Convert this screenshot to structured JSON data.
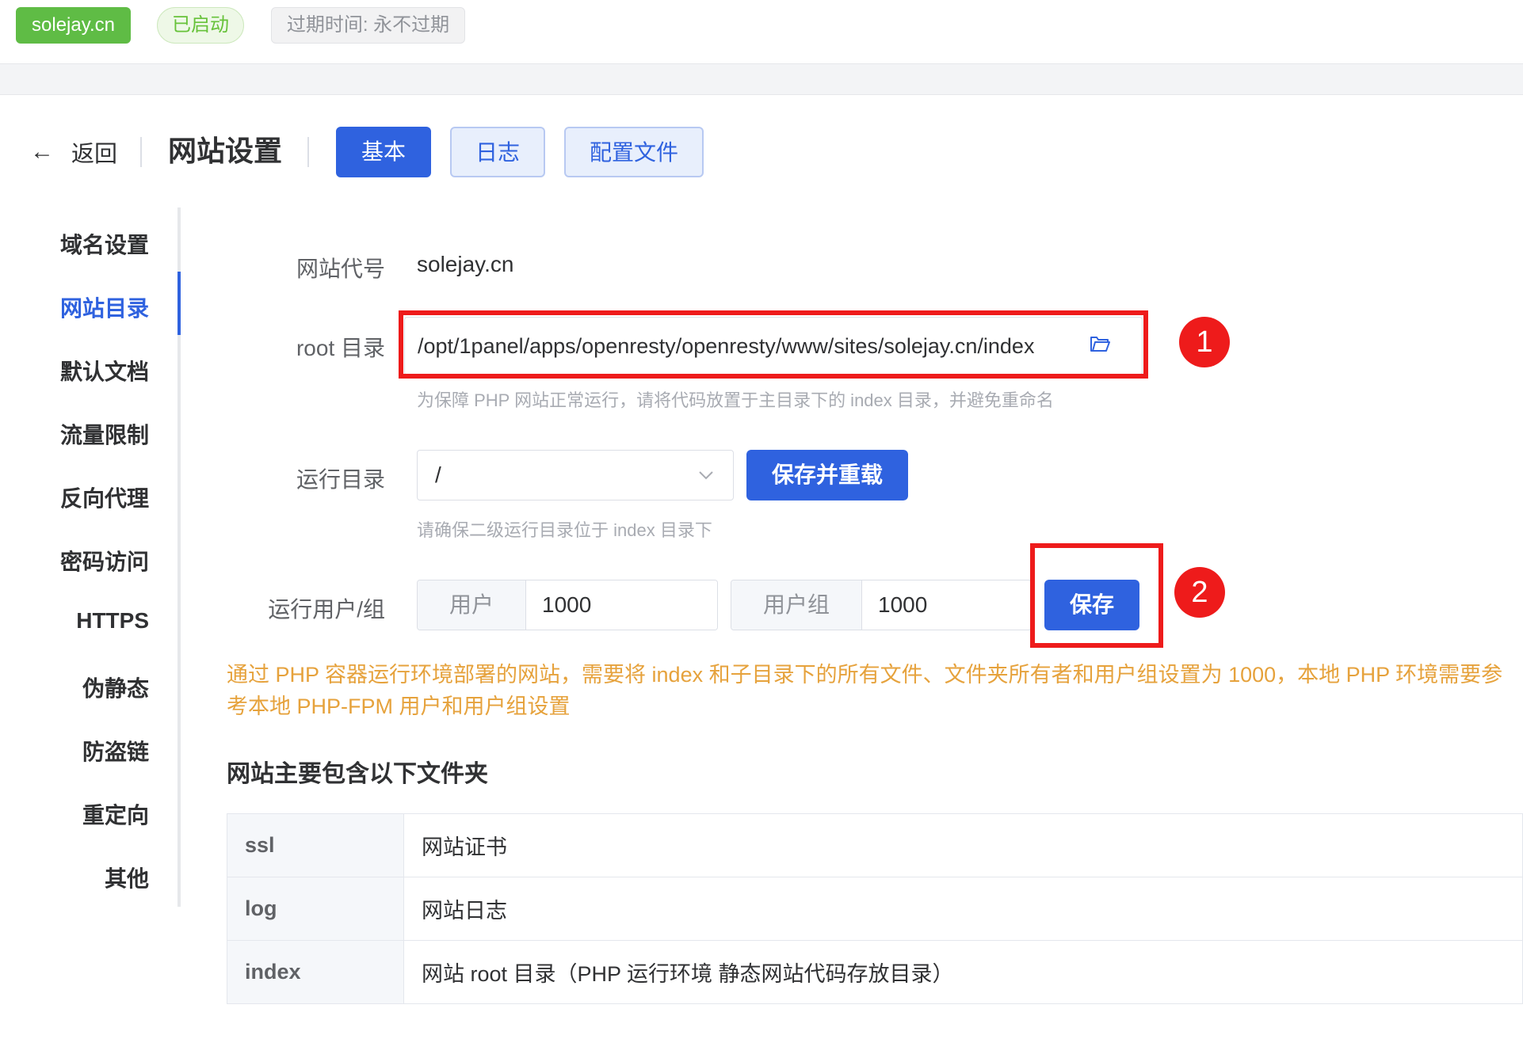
{
  "status_bar": {
    "domain_tag": "solejay.cn",
    "status_tag": "已启动",
    "expire_tag": "过期时间: 永不过期"
  },
  "header": {
    "back_label": "返回",
    "title": "网站设置",
    "tabs": [
      {
        "label": "基本",
        "active": true
      },
      {
        "label": "日志",
        "active": false
      },
      {
        "label": "配置文件",
        "active": false
      }
    ]
  },
  "sidebar": {
    "items": [
      {
        "label": "域名设置",
        "active": false
      },
      {
        "label": "网站目录",
        "active": true
      },
      {
        "label": "默认文档",
        "active": false
      },
      {
        "label": "流量限制",
        "active": false
      },
      {
        "label": "反向代理",
        "active": false
      },
      {
        "label": "密码访问",
        "active": false
      },
      {
        "label": "HTTPS",
        "active": false
      },
      {
        "label": "伪静态",
        "active": false
      },
      {
        "label": "防盗链",
        "active": false
      },
      {
        "label": "重定向",
        "active": false
      },
      {
        "label": "其他",
        "active": false
      }
    ]
  },
  "form": {
    "site_code_label": "网站代号",
    "site_code_value": "solejay.cn",
    "root_label": "root 目录",
    "root_value": "/opt/1panel/apps/openresty/openresty/www/sites/solejay.cn/index",
    "root_hint": "为保障 PHP 网站正常运行，请将代码放置于主目录下的 index 目录，并避免重命名",
    "run_dir_label": "运行目录",
    "run_dir_value": "/",
    "save_reload_label": "保存并重载",
    "run_dir_hint": "请确保二级运行目录位于 index 目录下",
    "run_user_label": "运行用户/组",
    "user_prefix": "用户",
    "user_value": "1000",
    "group_prefix": "用户组",
    "group_value": "1000",
    "save_label": "保存"
  },
  "warning": "通过 PHP 容器运行环境部署的网站，需要将 index 和子目录下的所有文件、文件夹所有者和用户组设置为 1000，本地 PHP 环境需要参考本地 PHP-FPM 用户和用户组设置",
  "folders": {
    "title": "网站主要包含以下文件夹",
    "rows": [
      {
        "name": "ssl",
        "desc": "网站证书"
      },
      {
        "name": "log",
        "desc": "网站日志"
      },
      {
        "name": "index",
        "desc": "网站 root 目录（PHP 运行环境 静态网站代码存放目录）"
      }
    ]
  },
  "annotations": {
    "badge1": "1",
    "badge2": "2"
  },
  "colors": {
    "primary": "#2f62df",
    "success": "#5fbc45",
    "warning": "#e6a23c",
    "annotation_red": "#ee1b1b"
  }
}
